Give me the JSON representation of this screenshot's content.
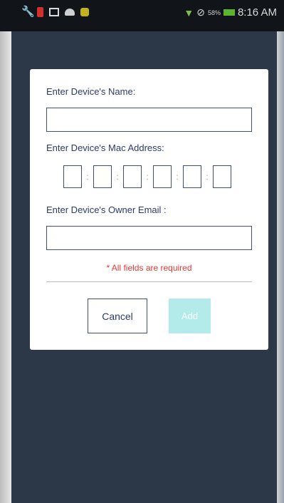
{
  "statusbar": {
    "time": "8:16 AM",
    "battery_percent": "58%",
    "icons": [
      "wrench-icon",
      "battery-alert-icon",
      "image-icon",
      "android-icon",
      "shopping-bag-icon",
      "wifi-icon",
      "no-sim-icon",
      "battery-icon"
    ]
  },
  "dialog": {
    "name_label": "Enter Device's Name:",
    "name_value": "",
    "mac_label": "Enter Device's Mac Address:",
    "mac_values": [
      "",
      "",
      "",
      "",
      "",
      ""
    ],
    "email_label": "Enter Device's Owner Email :",
    "email_value": "",
    "required_text": "* All fields are required",
    "cancel_label": "Cancel",
    "add_label": "Add"
  },
  "colors": {
    "app_background": "#2c3848",
    "label_text": "#2b3a67",
    "error_text": "#e53935",
    "add_disabled": "#b2ebe9"
  }
}
